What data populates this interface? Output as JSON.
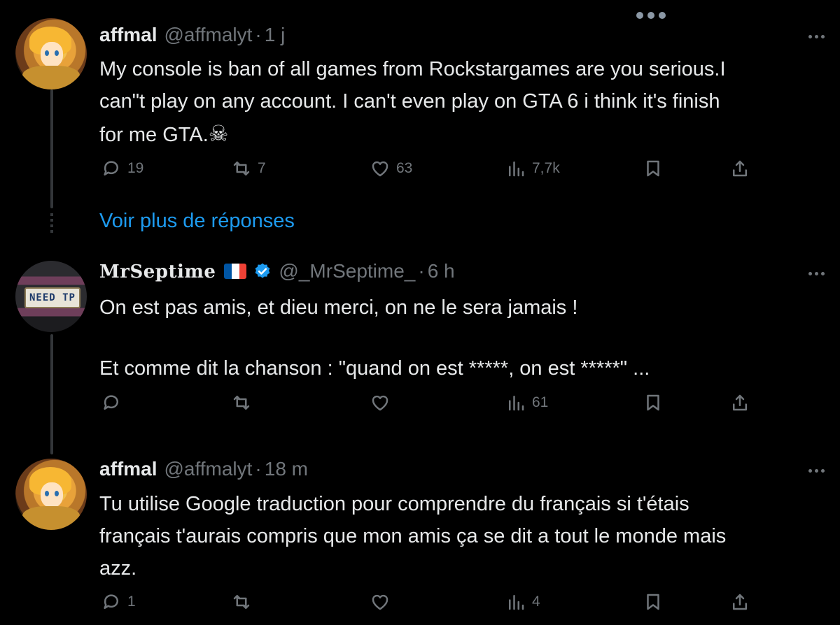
{
  "tweets": [
    {
      "name": "affmal",
      "handle": "@affmalyt",
      "separator": "·",
      "time": "1 j",
      "lines": [
        "My console is ban of all games from Rockstargames are you serious.I",
        "can\"t play on any account. I can't even play on GTA 6 i think it's finish",
        "for me GTA."
      ],
      "emoji": "☠",
      "stats": {
        "replies": "19",
        "reposts": "7",
        "likes": "63",
        "views": "7,7k"
      }
    },
    {
      "name": "MrSeptime",
      "handle": "@_MrSeptime_",
      "separator": "·",
      "time": "6 h",
      "flag_colors": [
        "#0055a4",
        "#ffffff",
        "#ef4135"
      ],
      "verified_color": "#1d9bf0",
      "avatar_plate_text": "NEED TP",
      "lines": [
        "On est pas amis, et dieu merci, on ne le sera jamais !",
        "",
        "Et comme dit la chanson : \"quand on est *****, on est *****\" ..."
      ],
      "stats": {
        "replies": "",
        "reposts": "",
        "likes": "",
        "views": "61"
      }
    },
    {
      "name": "affmal",
      "handle": "@affmalyt",
      "separator": "·",
      "time": "18 m",
      "lines": [
        "Tu utilise Google traduction pour comprendre du français si t'étais",
        "français t'aurais compris que mon amis ça se dit a tout le monde mais",
        "azz."
      ],
      "stats": {
        "replies": "1",
        "reposts": "",
        "likes": "",
        "views": "4"
      }
    }
  ],
  "more_replies_label": "Voir plus de réponses",
  "accent_color": "#1d9bf0",
  "icons": [
    "more-icon",
    "reply-icon",
    "repost-icon",
    "like-icon",
    "views-icon",
    "bookmark-icon",
    "share-icon",
    "skull-crossbones-icon",
    "verified-badge-icon",
    "french-flag-icon"
  ]
}
